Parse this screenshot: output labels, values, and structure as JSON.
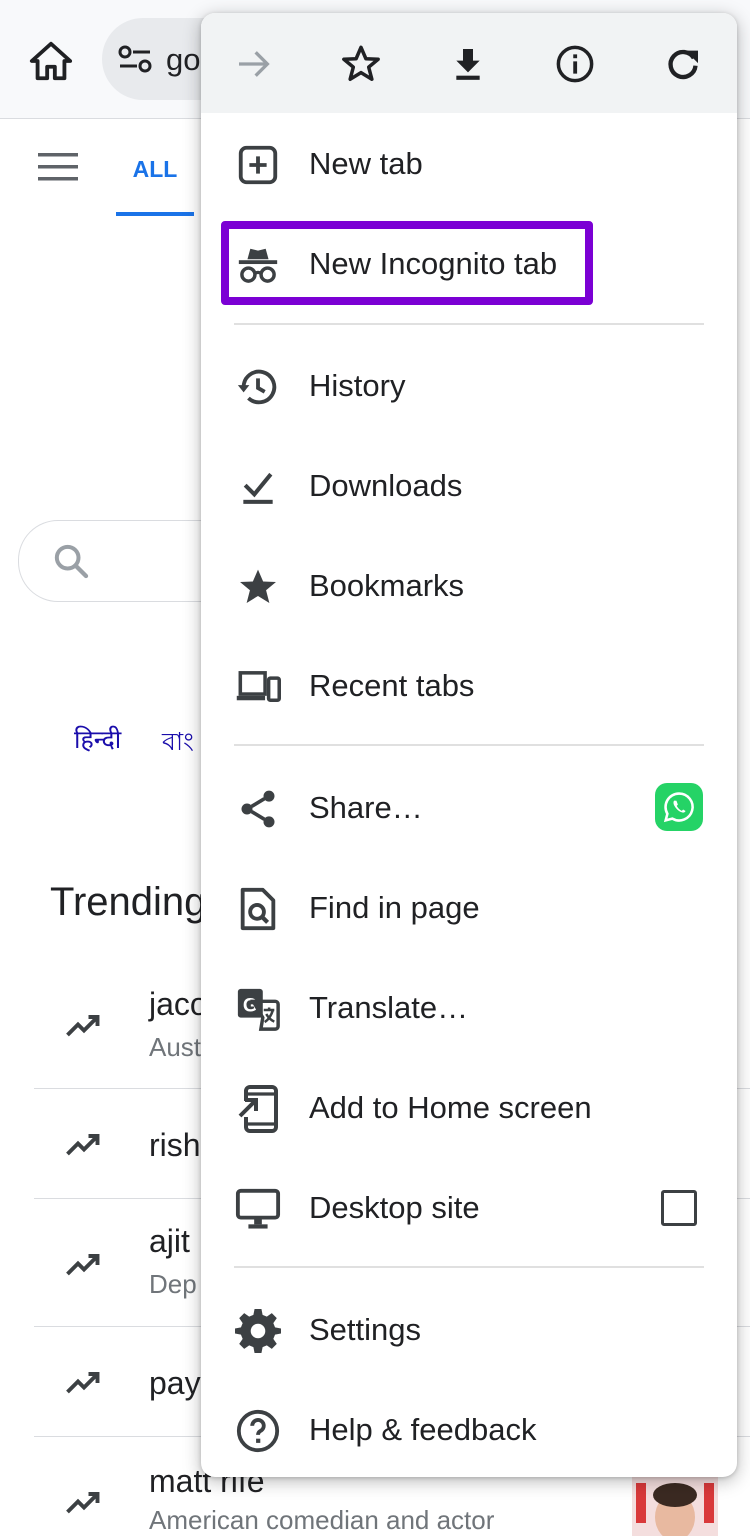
{
  "background_page": {
    "url_text": "go",
    "tab_all": "ALL",
    "languages": [
      "हिन्दी",
      "বাং"
    ],
    "trending_title": "Trending",
    "trending_items": [
      {
        "title": "jaco",
        "subtitle": "Aust"
      },
      {
        "title": "rish",
        "subtitle": ""
      },
      {
        "title": "ajit",
        "subtitle": "Dep"
      },
      {
        "title": "pay",
        "subtitle": ""
      },
      {
        "title": "matt rife",
        "subtitle": "American comedian and actor"
      }
    ]
  },
  "menu": {
    "toolbar": [
      {
        "name": "forward-icon",
        "enabled": false
      },
      {
        "name": "bookmark-star-icon",
        "enabled": true
      },
      {
        "name": "download-icon",
        "enabled": true
      },
      {
        "name": "page-info-icon",
        "enabled": true
      },
      {
        "name": "reload-icon",
        "enabled": true
      }
    ],
    "items": {
      "new_tab": "New tab",
      "new_incognito_tab": "New Incognito tab",
      "history": "History",
      "downloads": "Downloads",
      "bookmarks": "Bookmarks",
      "recent_tabs": "Recent tabs",
      "share": "Share…",
      "find_in_page": "Find in page",
      "translate": "Translate…",
      "add_to_home_screen": "Add to Home screen",
      "desktop_site": "Desktop site",
      "settings": "Settings",
      "help_feedback": "Help & feedback"
    },
    "desktop_site_checked": false
  },
  "colors": {
    "highlight_border": "#7b00d4",
    "accent_blue": "#1a73e8",
    "whatsapp_green": "#25d366",
    "icon_dark": "#3c4043",
    "disabled_icon": "#9aa0a6"
  }
}
